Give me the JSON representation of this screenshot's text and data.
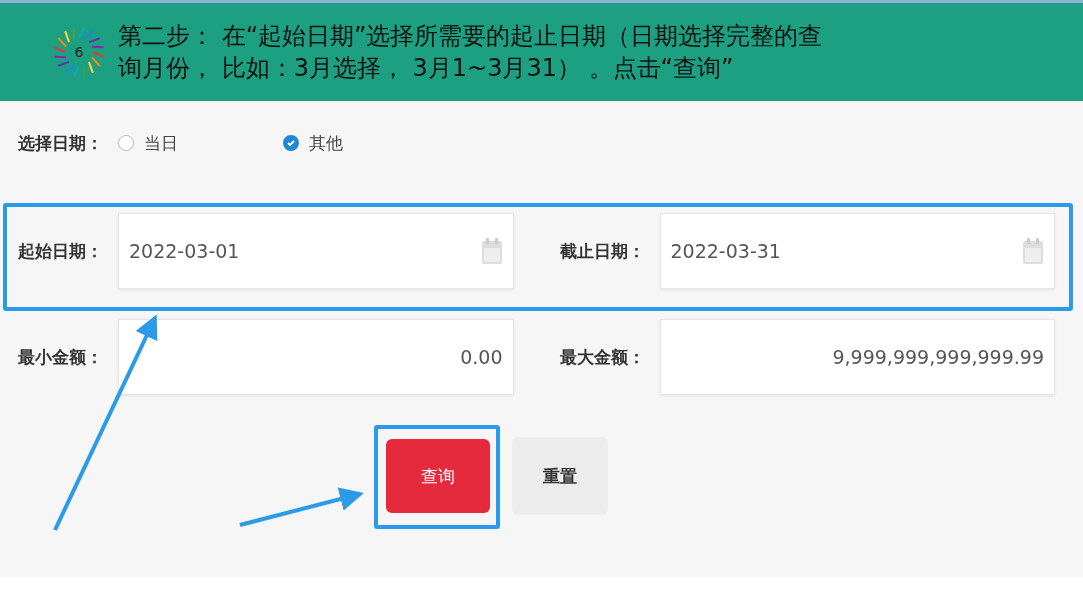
{
  "slide": {
    "step_number": "6",
    "title": "第二步： 在“起始日期”选择所需要的起止日期（日期选择完整的查询月份， 比如：3月选择， 3月1~3月31） 。点击“查询”"
  },
  "date_choice": {
    "label": "选择日期：",
    "options": [
      {
        "label": "当日",
        "selected": false
      },
      {
        "label": "其他",
        "selected": true
      }
    ]
  },
  "fields": [
    {
      "label": "起始日期：",
      "value": "2022-03-01",
      "kind": "date"
    },
    {
      "label": "截止日期：",
      "value": "2022-03-31",
      "kind": "date"
    },
    {
      "label": "最小金额：",
      "value": "0.00",
      "kind": "amount"
    },
    {
      "label": "最大金额：",
      "value": "9,999,999,999,999.99",
      "kind": "amount"
    }
  ],
  "buttons": [
    {
      "label": "查询",
      "kind": "primary"
    },
    {
      "label": "重置",
      "kind": "secondary"
    }
  ],
  "highlights": {
    "date_row": true,
    "query_button": true
  }
}
